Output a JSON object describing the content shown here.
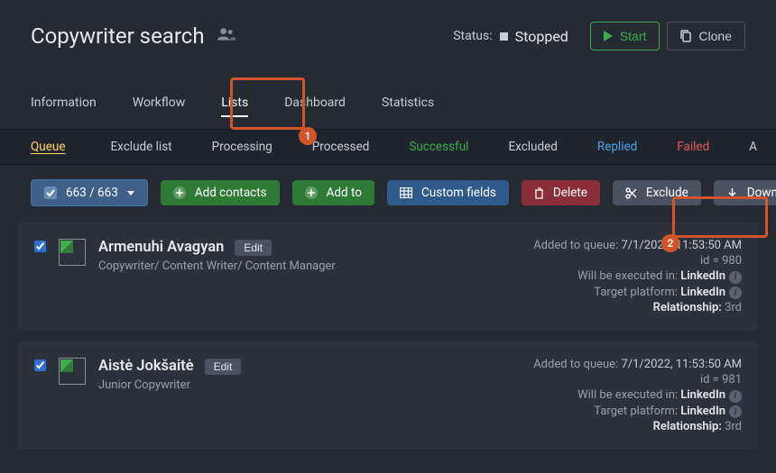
{
  "header": {
    "title": "Copywriter search",
    "status_label": "Status:",
    "status_value": "Stopped",
    "start_label": "Start",
    "clone_label": "Clone"
  },
  "nav": {
    "information": "Information",
    "workflow": "Workflow",
    "lists": "Lists",
    "dashboard": "Dashboard",
    "statistics": "Statistics"
  },
  "annotations": {
    "badge1": "1",
    "badge2": "2"
  },
  "filters": {
    "queue": "Queue",
    "exclude_list": "Exclude list",
    "processing": "Processing",
    "processed": "Processed",
    "successful": "Successful",
    "excluded": "Excluded",
    "replied": "Replied",
    "failed": "Failed",
    "all": "A"
  },
  "actions": {
    "select_count": "663 / 663",
    "add_contacts": "Add contacts",
    "add_to": "Add to",
    "custom_fields": "Custom fields",
    "delete": "Delete",
    "exclude": "Exclude",
    "download": "Download"
  },
  "contacts": [
    {
      "name": "Armenuhi Avagyan",
      "edit": "Edit",
      "subtitle": "Copywriter/ Content Writer/ Content Manager",
      "added_label": "Added to queue:",
      "added_value": "7/1/2022, 11:53:50 AM",
      "id_line": "id = 980",
      "execute_label": "Will be executed in:",
      "execute_value": "LinkedIn",
      "target_label": "Target platform:",
      "target_value": "LinkedIn",
      "relation_label": "Relationship:",
      "relation_value": "3rd"
    },
    {
      "name": "Aistė Jokšaitė",
      "edit": "Edit",
      "subtitle": "Junior Copywriter",
      "added_label": "Added to queue:",
      "added_value": "7/1/2022, 11:53:50 AM",
      "id_line": "id = 981",
      "execute_label": "Will be executed in:",
      "execute_value": "LinkedIn",
      "target_label": "Target platform:",
      "target_value": "LinkedIn",
      "relation_label": "Relationship:",
      "relation_value": "3rd"
    }
  ]
}
